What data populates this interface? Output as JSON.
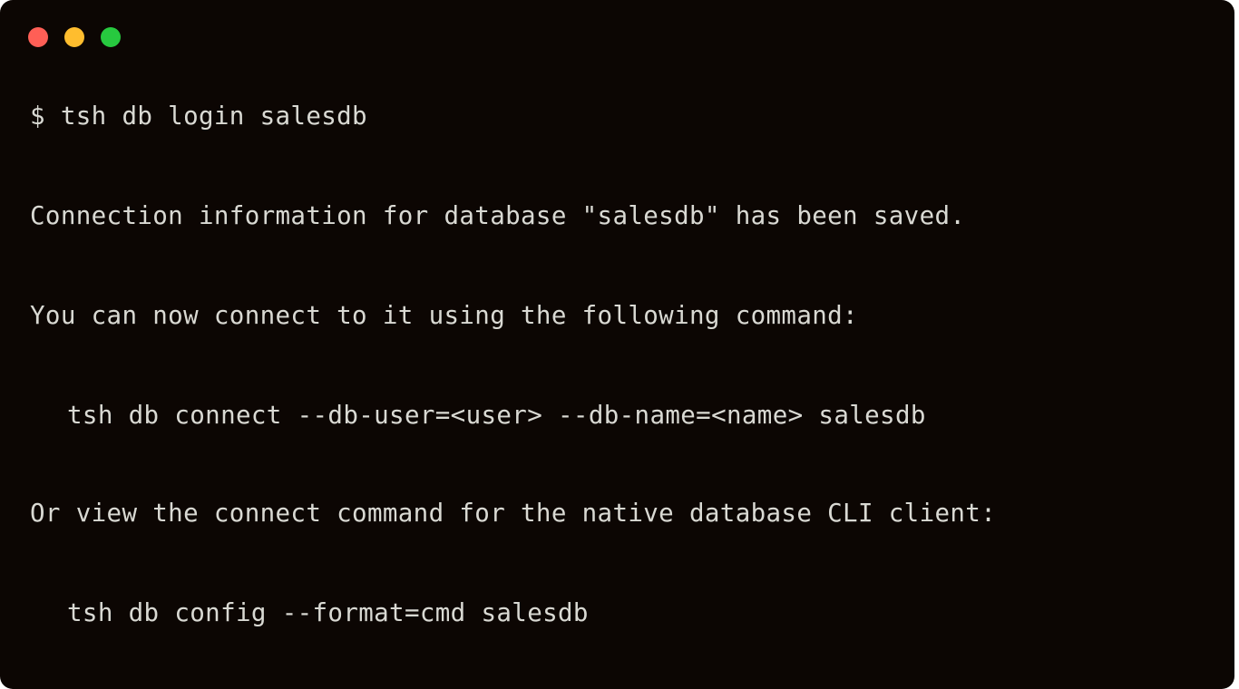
{
  "window": {
    "type": "terminal-window",
    "background_color": "#0C0603",
    "text_color": "#D9D9D3",
    "corner_radius_px": 14
  },
  "titlebar": {
    "controls": [
      {
        "name": "close",
        "label": "Close",
        "color": "#FF5F56"
      },
      {
        "name": "minimize",
        "label": "Minimize",
        "color": "#FFBD2E"
      },
      {
        "name": "maximize",
        "label": "Maximize",
        "color": "#27C93F"
      }
    ]
  },
  "terminal": {
    "prompt_symbol": "$",
    "lines": [
      {
        "id": "line-command-input",
        "text": "$ tsh db login salesdb",
        "kind": "prompt-command",
        "indented": false
      },
      {
        "id": "line-saved-confirmation",
        "text": "Connection information for database \"salesdb\" has been saved.",
        "kind": "output",
        "indented": false
      },
      {
        "id": "line-connect-instruction",
        "text": "You can now connect to it using the following command:",
        "kind": "output",
        "indented": false
      },
      {
        "id": "line-connect-command",
        "text": "tsh db connect --db-user=<user> --db-name=<name> salesdb",
        "kind": "output-command",
        "indented": true
      },
      {
        "id": "line-native-cli-instruction",
        "text": "Or view the connect command for the native database CLI client:",
        "kind": "output",
        "indented": false
      },
      {
        "id": "line-config-command",
        "text": "tsh db config --format=cmd salesdb",
        "kind": "output-command",
        "indented": true
      }
    ]
  }
}
